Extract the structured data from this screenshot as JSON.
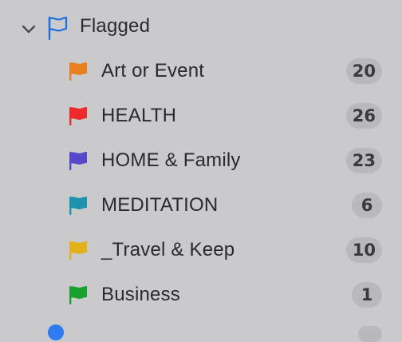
{
  "section": {
    "title": "Flagged",
    "chevron_icon": "chevron-down-icon",
    "flag_icon": "flag-outline-icon",
    "flag_color": "#1f6fe0"
  },
  "items": [
    {
      "label": "Art or Event",
      "count": "20",
      "color": "#e8801f"
    },
    {
      "label": "HEALTH",
      "count": "26",
      "color": "#f02a2a"
    },
    {
      "label": "HOME & Family",
      "count": "23",
      "color": "#5648c8"
    },
    {
      "label": "MEDITATION",
      "count": "6",
      "color": "#1b92ae"
    },
    {
      "label": "_Travel & Keep",
      "count": "10",
      "color": "#e3b21a"
    },
    {
      "label": "Business",
      "count": "1",
      "color": "#17a32e"
    }
  ],
  "colors": {
    "background": "#cacacc",
    "badge_background": "#b9b9bc",
    "next_section_icon": "#2f7bf1"
  }
}
